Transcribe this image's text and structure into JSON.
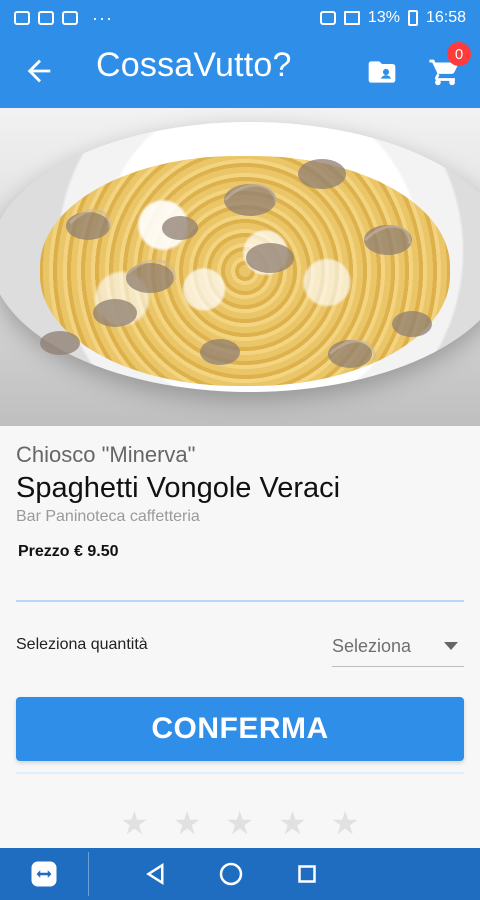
{
  "status_bar": {
    "battery_percent": "13%",
    "time": "16:58",
    "dots": "···",
    "icons": [
      "notification-icon",
      "image-icon",
      "mail-icon",
      "cast-icon",
      "signal-icon",
      "battery-icon"
    ]
  },
  "app_bar": {
    "title": "CossaVutto?",
    "back_icon": "arrow-left-icon",
    "folder_icon": "folder-user-icon",
    "cart_icon": "cart-icon",
    "cart_count": "0"
  },
  "product": {
    "vendor": "Chiosco \"Minerva\"",
    "name": "Spaghetti Vongole Veraci",
    "category": "Bar Paninoteca caffetteria",
    "price": "Prezzo € 9.50"
  },
  "quantity": {
    "label": "Seleziona quantità",
    "selected": "Seleziona"
  },
  "actions": {
    "confirm_label": "CONFERMA"
  },
  "rating": {
    "stars": 5,
    "filled": 0
  },
  "colors": {
    "primary": "#2f8fe8",
    "nav": "#1f6dc1",
    "badge": "#ff3b3b"
  }
}
